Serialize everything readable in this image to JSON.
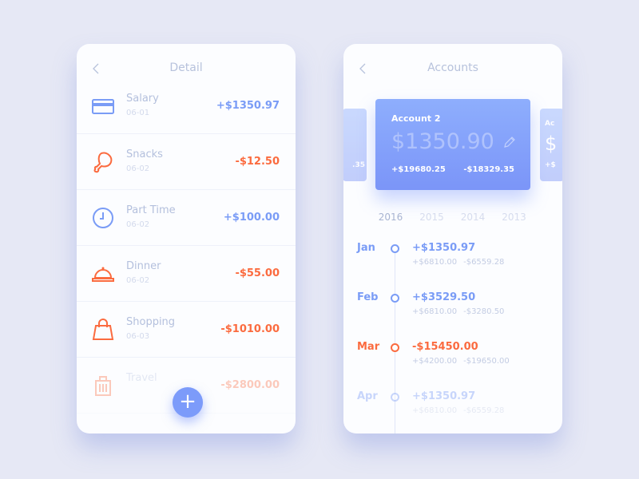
{
  "colors": {
    "positive": "#7a9cf6",
    "negative": "#fb6b3f",
    "card_start": "#8eaefd",
    "card_end": "#7b95f8"
  },
  "detail": {
    "title": "Detail",
    "back_icon": "chevron-left-icon",
    "add_icon": "plus-icon",
    "add_label": "+",
    "items": [
      {
        "name": "Salary",
        "date": "06-01",
        "amount": "+$1350.97",
        "type": "positive",
        "icon": "credit-card-icon"
      },
      {
        "name": "Snacks",
        "date": "06-02",
        "amount": "-$12.50",
        "type": "negative",
        "icon": "chicken-leg-icon"
      },
      {
        "name": "Part Time",
        "date": "06-02",
        "amount": "+$100.00",
        "type": "positive",
        "icon": "clock-icon"
      },
      {
        "name": "Dinner",
        "date": "06-02",
        "amount": "-$55.00",
        "type": "negative",
        "icon": "food-cloche-icon"
      },
      {
        "name": "Shopping",
        "date": "06-03",
        "amount": "-$1010.00",
        "type": "negative",
        "icon": "shopping-bag-icon"
      },
      {
        "name": "Travel",
        "date": "",
        "amount": "-$2800.00",
        "type": "negative",
        "icon": "luggage-icon"
      }
    ]
  },
  "accounts": {
    "title": "Accounts",
    "back_icon": "chevron-left-icon",
    "prev_card": {
      "partial_text": ".35"
    },
    "card": {
      "name": "Account 2",
      "balance": "$1350.90",
      "income": "+$19680.25",
      "expense": "-$18329.35",
      "edit_icon": "pencil-icon"
    },
    "next_card": {
      "partial_name": "Ac",
      "partial_balance": "$",
      "partial_income": "+$"
    },
    "years": [
      "2016",
      "2015",
      "2014",
      "2013"
    ],
    "selected_year": "2016",
    "months": [
      {
        "month": "Jan",
        "total": "+$1350.97",
        "income": "+$6810.00",
        "expense": "-$6559.28",
        "type": "positive"
      },
      {
        "month": "Feb",
        "total": "+$3529.50",
        "income": "+$6810.00",
        "expense": "-$3280.50",
        "type": "positive"
      },
      {
        "month": "Mar",
        "total": "-$15450.00",
        "income": "+$4200.00",
        "expense": "-$19650.00",
        "type": "negative"
      },
      {
        "month": "Apr",
        "total": "+$1350.97",
        "income": "+$6810.00",
        "expense": "-$6559.28",
        "type": "positive"
      }
    ]
  }
}
